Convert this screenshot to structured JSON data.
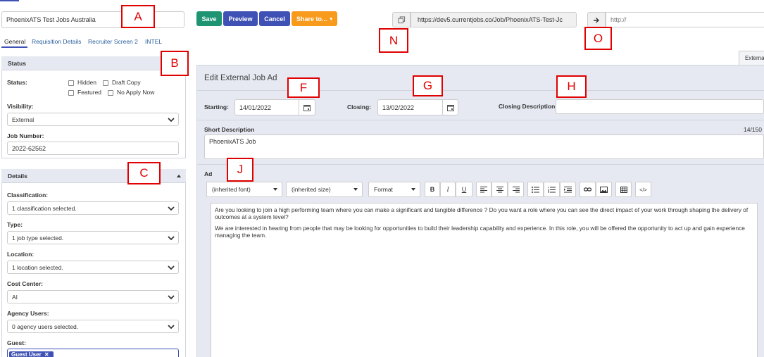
{
  "header": {
    "job_title_value": "PhoenixATS Test Jobs Australia",
    "save_label": "Save",
    "preview_label": "Preview",
    "cancel_label": "Cancel",
    "share_label": "Share to...",
    "job_url": "https://dev5.currentjobs.co/Job/PhoenixATS-Test-Jc",
    "redirect_placeholder": "http://"
  },
  "tabs": [
    "General",
    "Requisition Details",
    "Recruiter Screen 2",
    "INTEL"
  ],
  "annotations": {
    "a": "A",
    "b": "B",
    "c": "C",
    "f": "F",
    "g": "G",
    "h": "H",
    "j": "J",
    "n": "N",
    "o": "O"
  },
  "status_panel": {
    "title": "Status",
    "status_label": "Status:",
    "hidden": "Hidden",
    "draft_copy": "Draft Copy",
    "featured": "Featured",
    "no_apply_now": "No Apply Now",
    "visibility_label": "Visibility:",
    "visibility_value": "External",
    "job_number_label": "Job Number:",
    "job_number_value": "2022-62562"
  },
  "details_panel": {
    "title": "Details",
    "classification_label": "Classification:",
    "classification_value": "1 classification selected.",
    "type_label": "Type:",
    "type_value": "1 job type selected.",
    "location_label": "Location:",
    "location_value": "1 location selected.",
    "cost_center_label": "Cost Center:",
    "cost_center_value": "AI",
    "agency_users_label": "Agency Users:",
    "agency_users_value": "0 agency users selected.",
    "guest_label": "Guest:",
    "guest_tag": "Guest User"
  },
  "external_tab_label": "Externa",
  "editor": {
    "title": "Edit External Job Ad",
    "starting_label": "Starting:",
    "starting_value": "14/01/2022",
    "closing_label": "Closing:",
    "closing_value": "13/02/2022",
    "closing_description_label": "Closing Description:",
    "closing_description_value": "",
    "short_description_label": "Short Description",
    "short_description_count": "14/150",
    "short_description_value": "PhoenixATS Job",
    "ad_label": "Ad",
    "font_dropdown": "(inherited font)",
    "size_dropdown": "(inherited size)",
    "format_dropdown": "Format",
    "bold": "B",
    "italic": "I",
    "underline": "U",
    "html_toggle": "</>",
    "paragraph_1": "Are you looking to join a high performing team where you can make a significant and tangible difference ? Do you want a role where you can see the direct impact of your work through shaping the delivery of outcomes at a system level?",
    "paragraph_2": "We are interested in hearing from people that may be looking for opportunities to build their leadership capability and experience. In this role, you will be offered the opportunity to act up and gain experience managing the team."
  },
  "colors": {
    "save": "#1e9472",
    "preview": "#3f51b5",
    "cancel": "#3f51b5",
    "share": "#f89a1c",
    "annotation": "#e00000",
    "panel_bg": "#e6e9f2"
  }
}
